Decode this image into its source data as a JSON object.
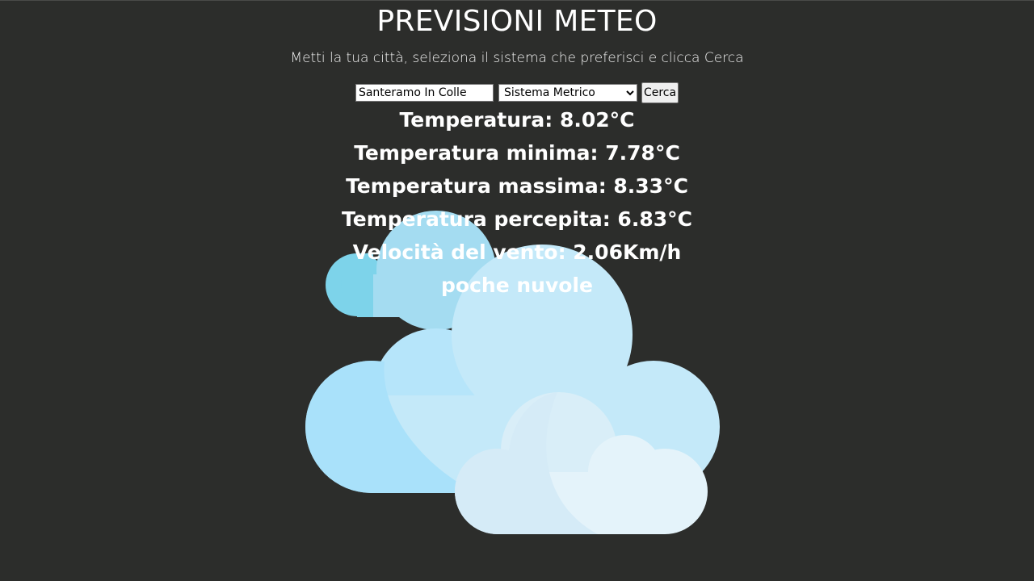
{
  "header": {
    "title": "PREVISIONI METEO",
    "subtitle": "Metti la tua città, seleziona il sistema che preferisci e clicca Cerca"
  },
  "form": {
    "city_value": "Santeramo In Colle",
    "unit_selected": "Sistema Metrico",
    "search_label": "Cerca"
  },
  "results": {
    "temperature_label": "Temperatura: ",
    "temperature_value": "8.02°C",
    "temp_min_label": "Temperatura minima: ",
    "temp_min_value": "7.78°C",
    "temp_max_label": "Temperatura massima: ",
    "temp_max_value": "8.33°C",
    "feels_like_label": "Temperatura percepita: ",
    "feels_like_value": "6.83°C",
    "wind_label": "Velocità del vento: ",
    "wind_value": "2.06Km/h",
    "description": "poche nuvole"
  },
  "icon": {
    "name": "few-clouds-icon",
    "colors": {
      "cloud_back_dark": "#7dd3ea",
      "cloud_back_light": "#a4dcf1",
      "cloud_main_left": "#a9e1fa",
      "cloud_main_right": "#c4e9f9",
      "cloud_front_left": "#d5ebf7",
      "cloud_front_right": "#e4f3fa",
      "background": "#2c2d2b"
    }
  }
}
